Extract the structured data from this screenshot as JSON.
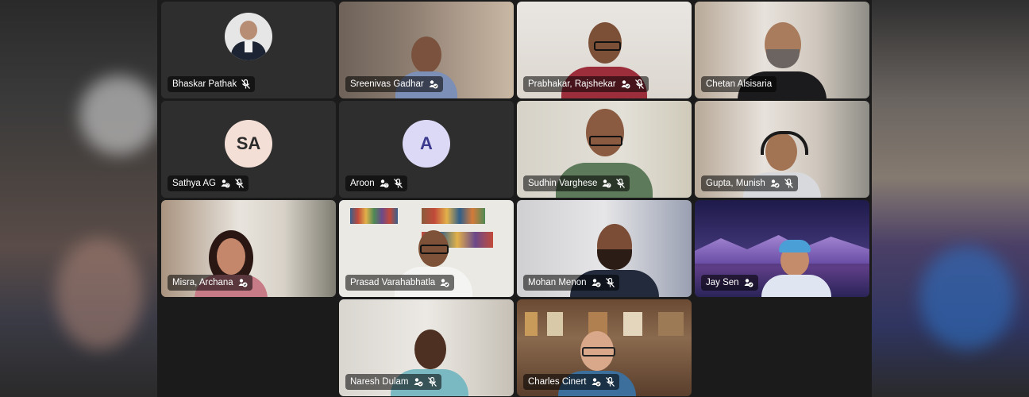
{
  "participants": [
    {
      "name": "Bhaskar Pathak",
      "badge": "",
      "muted": true
    },
    {
      "name": "Sreenivas Gadhar",
      "badge": "org",
      "muted": false
    },
    {
      "name": "Prabhakar, Rajshekar",
      "badge": "org",
      "muted": true
    },
    {
      "name": "Chetan Alsisaria",
      "badge": "",
      "muted": false
    },
    {
      "name": "Sathya AG",
      "initials": "SA",
      "badge": "guest",
      "muted": true
    },
    {
      "name": "Aroon",
      "initials": "A",
      "badge": "guest",
      "muted": true
    },
    {
      "name": "Sudhin Varghese",
      "badge": "guest",
      "muted": true
    },
    {
      "name": "Gupta, Munish",
      "badge": "org",
      "muted": true
    },
    {
      "name": "Misra, Archana",
      "badge": "org",
      "muted": false
    },
    {
      "name": "Prasad Varahabhatla",
      "badge": "org",
      "muted": false
    },
    {
      "name": "Mohan Menon",
      "badge": "org",
      "muted": true
    },
    {
      "name": "Jay Sen",
      "badge": "org",
      "muted": false
    },
    {
      "name": "Naresh Dulam",
      "badge": "org",
      "muted": true
    },
    {
      "name": "Charles Cinert",
      "badge": "org",
      "muted": true
    }
  ],
  "colors": {
    "active_speaker_outline": "#6f74d8",
    "stage_bg": "#1b1b1b"
  }
}
